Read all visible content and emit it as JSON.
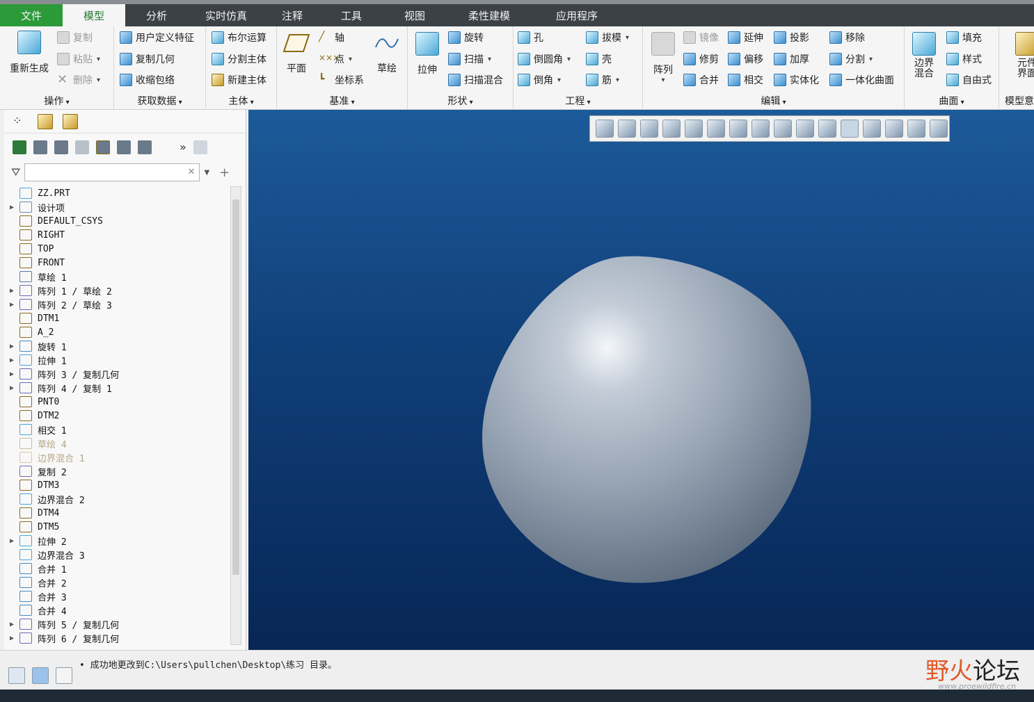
{
  "menu_tabs": [
    "文件",
    "模型",
    "分析",
    "实时仿真",
    "注释",
    "工具",
    "视图",
    "柔性建模",
    "应用程序"
  ],
  "ribbon": {
    "ops": {
      "label": "操作",
      "regen": "重新生成",
      "copy": "复制",
      "paste": "粘贴",
      "delete": "删除"
    },
    "data": {
      "label": "获取数据",
      "udf": "用户定义特征",
      "copy_geom": "复制几何",
      "shrinkwrap": "收缩包络"
    },
    "body": {
      "label": "主体",
      "boolean": "布尔运算",
      "split_body": "分割主体",
      "new_body": "新建主体"
    },
    "datum": {
      "label": "基准",
      "plane": "平面",
      "axis": "轴",
      "point": "点",
      "csys": "坐标系",
      "sketch": "草绘"
    },
    "shapes": {
      "label": "形状",
      "extrude": "拉伸",
      "revolve": "旋转",
      "sweep": "扫描",
      "swept_blend": "扫描混合"
    },
    "eng": {
      "label": "工程",
      "hole": "孔",
      "round": "倒圆角",
      "chamfer": "倒角",
      "draft": "拔模",
      "shell": "壳",
      "rib": "筋"
    },
    "edit": {
      "label": "编辑",
      "pattern": "阵列",
      "mirror": "镜像",
      "trim": "修剪",
      "merge": "合并",
      "extend": "延伸",
      "offset": "偏移",
      "intersect": "相交",
      "project": "投影",
      "thicken": "加厚",
      "solidify": "实体化",
      "remove": "移除",
      "split": "分割",
      "unify": "一体化曲面"
    },
    "surf": {
      "label": "曲面",
      "boundary_blend": "边界\n混合",
      "fill": "填充",
      "style": "样式",
      "freestyle": "自由式"
    },
    "model_intent": {
      "label": "模型意",
      "item": "元件\n界面"
    }
  },
  "search": {
    "placeholder": ""
  },
  "tree": [
    {
      "label": "ZZ.PRT",
      "exp": false,
      "icon": "part-icon",
      "color": "#4aa7d6"
    },
    {
      "label": "设计项",
      "exp": true,
      "icon": "design-items-icon",
      "color": "#6a8ab0"
    },
    {
      "label": "DEFAULT_CSYS",
      "exp": false,
      "icon": "csys-icon",
      "color": "#8a6a20"
    },
    {
      "label": "RIGHT",
      "exp": false,
      "icon": "datum-plane-icon",
      "color": "#8a6a20"
    },
    {
      "label": "TOP",
      "exp": false,
      "icon": "datum-plane-icon",
      "color": "#8a6a20"
    },
    {
      "label": "FRONT",
      "exp": false,
      "icon": "datum-plane-icon",
      "color": "#8a6a20"
    },
    {
      "label": "草绘 1",
      "exp": false,
      "icon": "sketch-icon",
      "color": "#5a7ab0"
    },
    {
      "label": "阵列 1 / 草绘 2",
      "exp": true,
      "icon": "pattern-icon",
      "color": "#6a6ab0"
    },
    {
      "label": "阵列 2 / 草绘 3",
      "exp": true,
      "icon": "pattern-icon",
      "color": "#6a6ab0"
    },
    {
      "label": "DTM1",
      "exp": false,
      "icon": "datum-plane-icon",
      "color": "#8a6a20"
    },
    {
      "label": "A_2",
      "exp": false,
      "icon": "axis-icon",
      "color": "#8a6a20"
    },
    {
      "label": "旋转 1",
      "exp": true,
      "icon": "revolve-icon",
      "color": "#4a8ac0"
    },
    {
      "label": "拉伸 1",
      "exp": true,
      "icon": "extrude-icon",
      "color": "#4aa7d6"
    },
    {
      "label": "阵列 3 / 复制几何",
      "exp": true,
      "icon": "pattern-icon",
      "color": "#6a6ab0"
    },
    {
      "label": "阵列 4 / 复制 1",
      "exp": true,
      "icon": "pattern-icon",
      "color": "#6a6ab0"
    },
    {
      "label": "PNT0",
      "exp": false,
      "icon": "datum-point-icon",
      "color": "#8a6a20"
    },
    {
      "label": "DTM2",
      "exp": false,
      "icon": "datum-plane-icon",
      "color": "#8a6a20"
    },
    {
      "label": "相交 1",
      "exp": false,
      "icon": "intersect-icon",
      "color": "#4aa7d6"
    },
    {
      "label": "草绘 4",
      "exp": false,
      "icon": "sketch-icon",
      "color": "#c8bfa0",
      "dim": true
    },
    {
      "label": "边界混合 1",
      "exp": false,
      "icon": "boundary-blend-icon",
      "color": "#d8c8a0",
      "dim": true
    },
    {
      "label": "复制 2",
      "exp": false,
      "icon": "copy-surface-icon",
      "color": "#7a6ab0"
    },
    {
      "label": "DTM3",
      "exp": false,
      "icon": "datum-plane-icon",
      "color": "#8a6a20"
    },
    {
      "label": "边界混合 2",
      "exp": false,
      "icon": "boundary-blend-icon",
      "color": "#4aa7d6"
    },
    {
      "label": "DTM4",
      "exp": false,
      "icon": "datum-plane-icon",
      "color": "#8a6a20"
    },
    {
      "label": "DTM5",
      "exp": false,
      "icon": "datum-plane-icon",
      "color": "#8a6a20"
    },
    {
      "label": "拉伸 2",
      "exp": true,
      "icon": "extrude-icon",
      "color": "#4aa7d6"
    },
    {
      "label": "边界混合 3",
      "exp": false,
      "icon": "boundary-blend-icon",
      "color": "#4aa7d6"
    },
    {
      "label": "合并 1",
      "exp": false,
      "icon": "merge-icon",
      "color": "#4a8ac0"
    },
    {
      "label": "合并 2",
      "exp": false,
      "icon": "merge-icon",
      "color": "#4a8ac0"
    },
    {
      "label": "合并 3",
      "exp": false,
      "icon": "merge-icon",
      "color": "#4a8ac0"
    },
    {
      "label": "合并 4",
      "exp": false,
      "icon": "merge-icon",
      "color": "#4a8ac0"
    },
    {
      "label": "阵列 5 / 复制几何",
      "exp": true,
      "icon": "pattern-icon",
      "color": "#6a6ab0"
    },
    {
      "label": "阵列 6 / 复制几何",
      "exp": true,
      "icon": "pattern-icon",
      "color": "#6a6ab0"
    }
  ],
  "status": {
    "message": "成功地更改到C:\\Users\\pullchen\\Desktop\\练习 目录。"
  },
  "watermark": {
    "text1": "野火",
    "text2": "论坛",
    "url": "www.proewildfire.cn"
  },
  "colors": {
    "viewport_top": "#1d5a9a",
    "viewport_bottom": "#072656",
    "file_tab": "#2d9a3a",
    "model_shape": "#9aa8b8"
  }
}
